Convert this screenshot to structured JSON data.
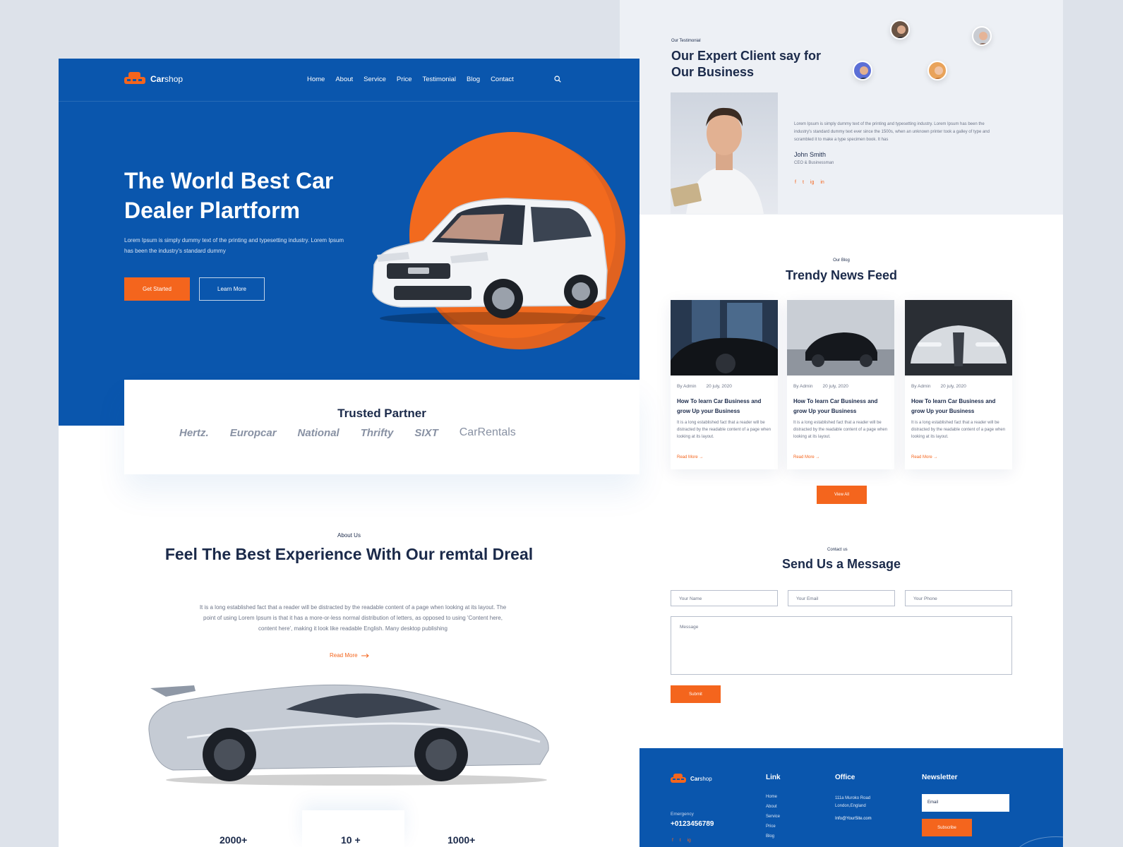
{
  "brand": {
    "name_bold": "Car",
    "name_light": "shop"
  },
  "nav": {
    "items": [
      "Home",
      "About",
      "Service",
      "Price",
      "Testimonial",
      "Blog",
      "Contact"
    ]
  },
  "hero": {
    "title": "The World Best Car Dealer Plartform",
    "subtitle": "Lorem Ipsum is simply dummy text of the printing and typesetting industry. Lorem Ipsum has been the industry's standard dummy",
    "primary_cta": "Get Started",
    "secondary_cta": "Learn More"
  },
  "partners": {
    "title": "Trusted Partner",
    "logos": [
      "Hertz.",
      "Europcar",
      "National",
      "Thrifty",
      "SIXT",
      "CarRentals"
    ]
  },
  "about": {
    "kicker": "About Us",
    "title": "Feel The Best Experience With Our remtal Dreal",
    "text": "It is a long established fact that a reader will be distracted by the readable content of a page when looking at its layout. The point of using Lorem Ipsum is that it has a more-or-less normal distribution of letters, as opposed to using 'Content here, content here', making it look like readable English. Many desktop publishing",
    "link": "Read More"
  },
  "stats": [
    "2000+",
    "10 +",
    "1000+"
  ],
  "testimonial": {
    "kicker": "Our Testimonial",
    "title": "Our Expert Client say for Our Business",
    "quote": "Lorem Ipsum is simply dummy text of the printing and typesetting industry. Lorem Ipsum has been the industry's standard dummy text ever since the 1500s, when an unknown printer took a galley of type and scrambled it to make a type specimen book. It has",
    "name": "John Smith",
    "role": "CEO & Businessman",
    "socials": [
      "f",
      "t",
      "ig",
      "in"
    ]
  },
  "blog": {
    "kicker": "Our Blog",
    "title": "Trendy News Feed",
    "cards": [
      {
        "author": "By Admin",
        "date": "20 july, 2020",
        "title": "How To learn Car Business and grow Up your Business",
        "text": "It is a long established fact that a reader will be distracted by the readable content of a page when looking at its layout.",
        "link": "Read More"
      },
      {
        "author": "By Admin",
        "date": "20 july, 2020",
        "title": "How To learn Car Business and grow Up your Business",
        "text": "It is a long established fact that a reader will be distracted by the readable content of a page when looking at its layout.",
        "link": "Read More"
      },
      {
        "author": "By Admin",
        "date": "20 july, 2020",
        "title": "How To learn Car Business and grow Up your Business",
        "text": "It is a long established fact that a reader will be distracted by the readable content of a page when looking at its layout.",
        "link": "Read More"
      }
    ],
    "view_all": "View All"
  },
  "contact": {
    "kicker": "Contact us",
    "title": "Send Us a Message",
    "name_placeholder": "Your Name",
    "email_placeholder": "Your Email",
    "phone_placeholder": "Your Phone",
    "message_placeholder": "Message",
    "submit": "Submit"
  },
  "footer": {
    "emergency_label": "Emergency",
    "phone": "+0123456789",
    "link_heading": "Link",
    "links": [
      "Home",
      "About",
      "Service",
      "Price",
      "Blog"
    ],
    "office_heading": "Office",
    "address": "111a Muroko Road London,England",
    "email": "Info@YourSite.com",
    "newsletter_heading": "Newsletter",
    "email_placeholder": "Email",
    "subscribe": "Subscribe",
    "socials": [
      "f",
      "t",
      "ig"
    ]
  },
  "colors": {
    "primary": "#0a56ad",
    "accent": "#f4651d",
    "text": "#1b2a4a"
  }
}
